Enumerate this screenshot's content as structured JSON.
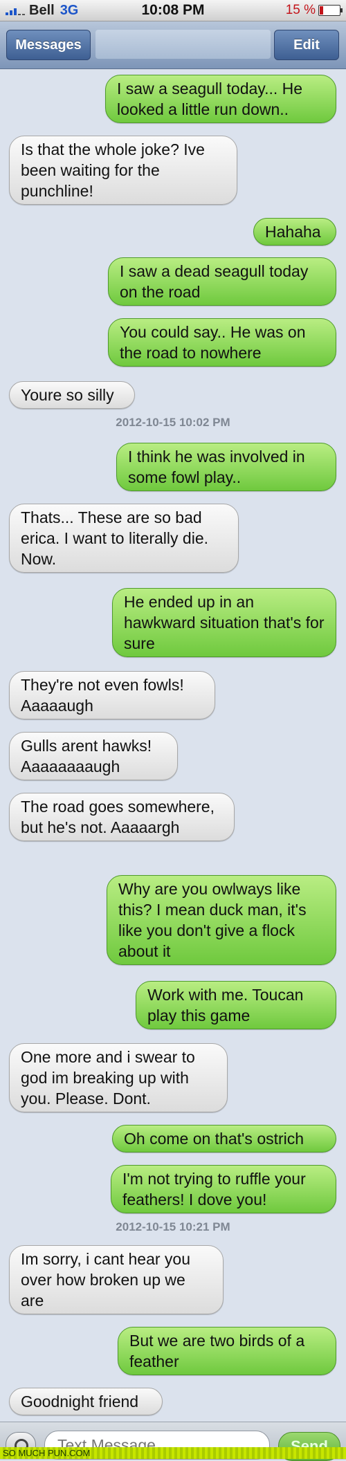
{
  "status_bar": {
    "carrier": "Bell",
    "network": "3G",
    "time": "10:08 PM",
    "battery": "15 %"
  },
  "nav": {
    "back_label": "Messages",
    "edit_label": "Edit"
  },
  "messages": [
    {
      "side": "out",
      "text": "I saw a seagull today... He looked a little run down.."
    },
    {
      "side": "in",
      "text": "Is that the whole joke? Ive been waiting for the punchline!"
    },
    {
      "side": "out",
      "text": "Hahaha"
    },
    {
      "side": "out",
      "text": "I saw a dead seagull today on the road"
    },
    {
      "side": "out",
      "text": "You could say.. He was on the road to nowhere"
    },
    {
      "side": "in",
      "text": "Youre so silly"
    },
    {
      "type": "timestamp",
      "text": "2012-10-15 10:02 PM"
    },
    {
      "side": "out",
      "text": "I think he was involved in some fowl play.."
    },
    {
      "side": "in",
      "text": "Thats... These are so bad erica. I want to literally die. Now."
    },
    {
      "side": "out",
      "text": "He ended up in an hawkward situation that's for sure"
    },
    {
      "side": "in",
      "text": "They're not even fowls! Aaaaaugh"
    },
    {
      "side": "in",
      "text": "Gulls arent hawks! Aaaaaaaaugh"
    },
    {
      "side": "in",
      "text": "The road goes somewhere, but he's not. Aaaaargh"
    },
    {
      "side": "out",
      "text": "Why are you owlways like this? I mean duck man, it's like you don't give a flock about it"
    },
    {
      "side": "out",
      "text": "Work with me. Toucan play this game"
    },
    {
      "side": "in",
      "text": "One more and i swear to god im breaking up with you. Please. Dont."
    },
    {
      "side": "out",
      "text": "Oh come on that's ostrich"
    },
    {
      "side": "out",
      "text": "I'm not trying to ruffle your feathers! I dove you!"
    },
    {
      "type": "timestamp",
      "text": "2012-10-15 10:21 PM"
    },
    {
      "side": "in",
      "text": "Im sorry, i cant hear you over how broken up we are"
    },
    {
      "side": "out",
      "text": "But we are two birds of a feather"
    },
    {
      "side": "in",
      "text": "Goodnight friend"
    }
  ],
  "composer": {
    "placeholder": "Text Message",
    "send_label": "Send"
  },
  "watermark": "SO MUCH PUN.COM"
}
